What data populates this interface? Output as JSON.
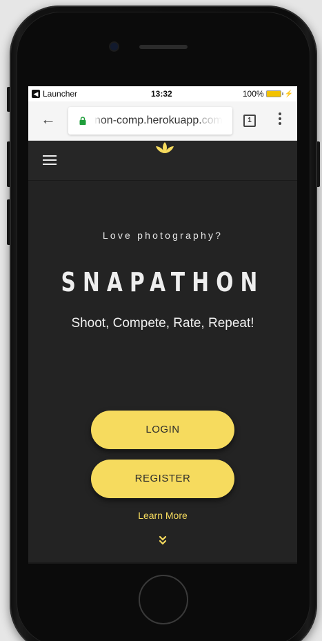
{
  "status_bar": {
    "app_label": "Launcher",
    "time": "13:32",
    "battery": "100%"
  },
  "browser": {
    "url_visible": "non-comp.herokuapp.",
    "url_faded": "com",
    "tab_count": "1"
  },
  "hero": {
    "tagline": "Love photography?",
    "brand": "SNAPATHON",
    "subtitle": "Shoot, Compete, Rate, Repeat!"
  },
  "actions": {
    "login_label": "LOGIN",
    "register_label": "REGISTER",
    "learn_more_label": "Learn More"
  },
  "icons": {
    "back": "arrow-left-icon",
    "lock": "lock-icon",
    "menu": "hamburger-icon",
    "more": "vertical-dots-icon",
    "logo": "lotus-icon",
    "scroll": "double-chevron-down-icon"
  },
  "colors": {
    "accent": "#f6db5e",
    "background": "#232323",
    "secure": "#1e9e3a"
  }
}
